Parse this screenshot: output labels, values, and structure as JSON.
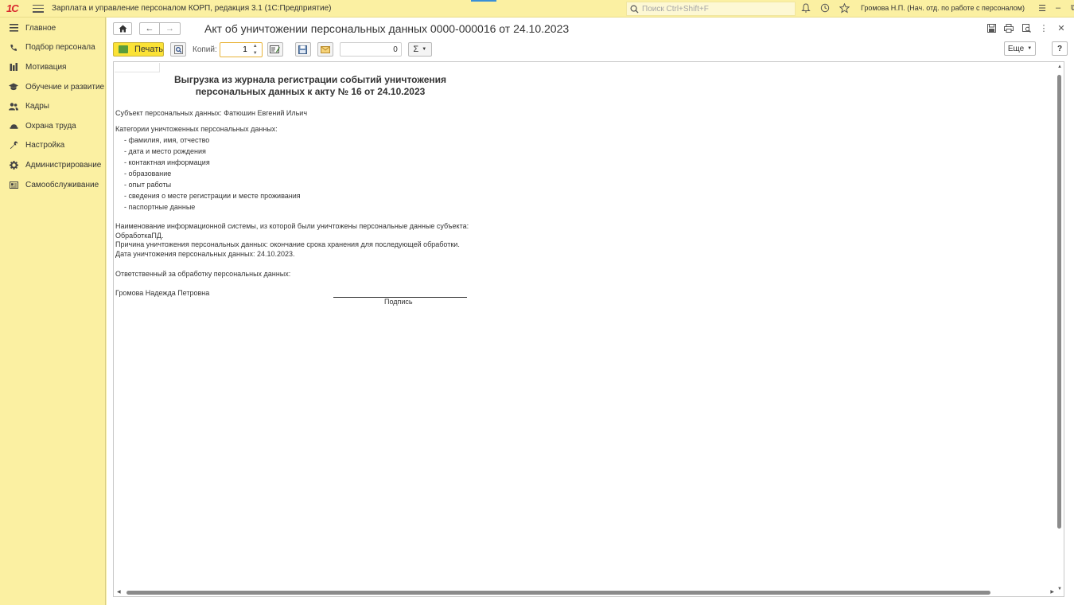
{
  "app": {
    "logo": "1С",
    "title": "Зарплата и управление персоналом КОРП, редакция 3.1  (1С:Предприятие)",
    "search_placeholder": "Поиск Ctrl+Shift+F",
    "user": "Громова Н.П. (Нач. отд. по работе с персоналом)"
  },
  "sidebar": {
    "items": [
      {
        "label": "Главное",
        "icon": "menu-lines-icon"
      },
      {
        "label": "Подбор персонала",
        "icon": "phone-icon"
      },
      {
        "label": "Мотивация",
        "icon": "bars-icon"
      },
      {
        "label": "Обучение и развитие",
        "icon": "graduation-cap-icon"
      },
      {
        "label": "Кадры",
        "icon": "people-icon"
      },
      {
        "label": "Охрана труда",
        "icon": "helmet-icon"
      },
      {
        "label": "Настройка",
        "icon": "wrench-icon"
      },
      {
        "label": "Администрирование",
        "icon": "gear-icon"
      },
      {
        "label": "Самообслуживание",
        "icon": "card-icon"
      }
    ]
  },
  "window": {
    "title": "Акт об уничтожении персональных данных 0000-000016 от 24.10.2023"
  },
  "toolbar": {
    "print_label": "Печать",
    "copies_label": "Копий:",
    "copies_value": "1",
    "sum_value": "0",
    "more_label": "Еще",
    "help_label": "?"
  },
  "document": {
    "heading_line1": "Выгрузка из журнала регистрации событий уничтожения",
    "heading_line2": "персональных данных к акту № 16 от 24.10.2023",
    "subject": "Субъект персональных данных: Фатюшин Евгений Ильич",
    "categories_title": "Категории уничтоженных персональных данных:",
    "categories": [
      "- фамилия, имя, отчество",
      "- дата и место рождения",
      "- контактная информация",
      "- образование",
      "- опыт работы",
      "- сведения о месте регистрации и месте проживания",
      "- паспортные данные"
    ],
    "system_line": "Наименование информационной системы, из которой были уничтожены персональные данные субъекта:",
    "system_name": "ОбработкаПД.",
    "reason": "Причина уничтожения персональных данных: окончание срока хранения для последующей обработки.",
    "date": "Дата уничтожения персональных данных: 24.10.2023.",
    "responsible_title": "Ответственный за обработку персональных данных:",
    "responsible_name": "Громова Надежда Петровна",
    "signature_label": "Подпись"
  }
}
